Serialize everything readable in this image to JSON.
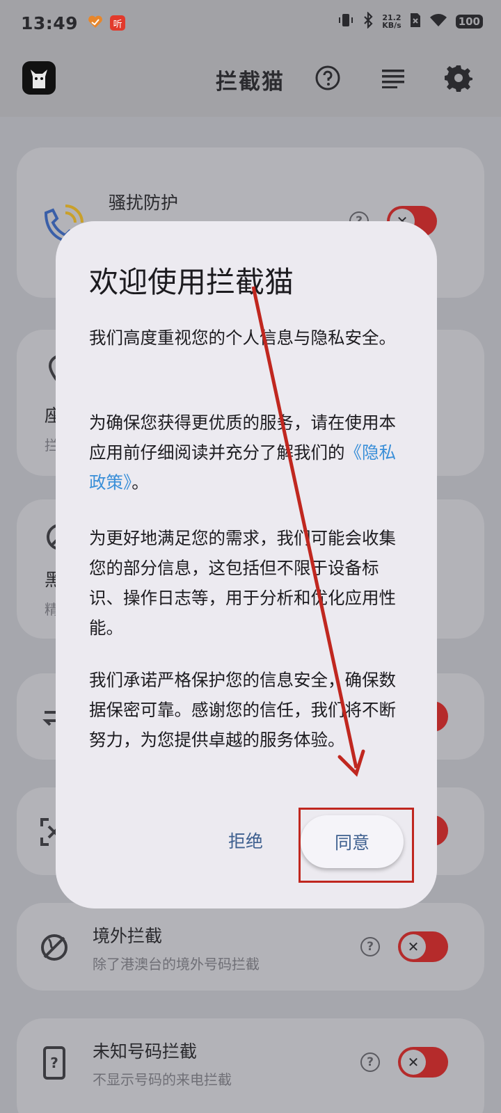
{
  "status_bar": {
    "time": "13:49",
    "app_badge": "听",
    "speed_value": "21.2",
    "speed_unit": "KB/s",
    "battery": "100"
  },
  "app_bar": {
    "title": "拦截猫",
    "icons": [
      "app-logo",
      "help-circle-icon",
      "list-icon",
      "gear-icon"
    ]
  },
  "cards": [
    {
      "title": "骚扰防护",
      "subtitle": "",
      "icon": "phone-wave-icon"
    },
    {
      "title": "座",
      "subtitle": "拦",
      "icon": "location-pin-icon"
    },
    {
      "title": "黑",
      "subtitle": "精",
      "icon": "block-circle-icon"
    },
    {
      "title": "",
      "subtitle": "",
      "icon": "transfer-icon"
    },
    {
      "title": "",
      "subtitle": "",
      "icon": "scan-x-icon"
    },
    {
      "title": "境外拦截",
      "subtitle": "除了港澳台的境外号码拦截",
      "icon": "globe-block-icon"
    },
    {
      "title": "未知号码拦截",
      "subtitle": "不显示号码的来电拦截",
      "icon": "unknown-phone-icon"
    }
  ],
  "dialog": {
    "title": "欢迎使用拦截猫",
    "para1": "我们高度重视您的个人信息与隐私安全。",
    "para2_before": "为确保您获得更优质的服务，请在使用本应用前仔细阅读并充分了解我们的",
    "para2_link": "《隐私政策》",
    "para2_after": "。",
    "para3": "为更好地满足您的需求，我们可能会收集您的部分信息，这包括但不限于设备标识、操作日志等，用于分析和优化应用性能。",
    "para4": "我们承诺严格保护您的信息安全，确保数据保密可靠。感谢您的信任，我们将不断努力，为您提供卓越的服务体验。",
    "reject_label": "拒绝",
    "agree_label": "同意"
  },
  "colors": {
    "toggle_on": "#b52b2b",
    "link": "#3a8fd8",
    "button_text": "#3d5f8f",
    "annotation": "#c0271f"
  }
}
